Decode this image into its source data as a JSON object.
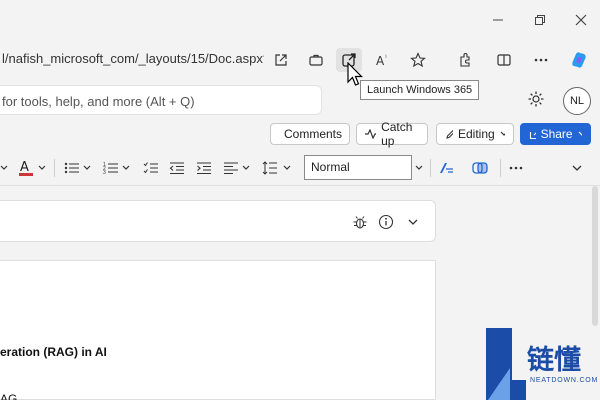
{
  "browser": {
    "url": "l/nafish_microsoft_com/_layouts/15/Doc.aspx?s...",
    "tooltip": "Launch Windows 365"
  },
  "search": {
    "placeholder": "for tools, help, and more (Alt + Q)"
  },
  "account": {
    "initials": "NL"
  },
  "commands": {
    "comments": "Comments",
    "catch_up": "Catch up",
    "editing": "Editing",
    "share": "Share"
  },
  "ribbon": {
    "style_value": "Normal"
  },
  "document": {
    "heading_fragment": "eration (RAG) in AI",
    "text_fragment": "AG"
  },
  "watermark": {
    "brand": "链懂",
    "site": "NEATDOWN.COM"
  },
  "colors": {
    "accent": "#2266d6",
    "font_color_underline": "#d13438",
    "watermark": "#1b4da8"
  }
}
